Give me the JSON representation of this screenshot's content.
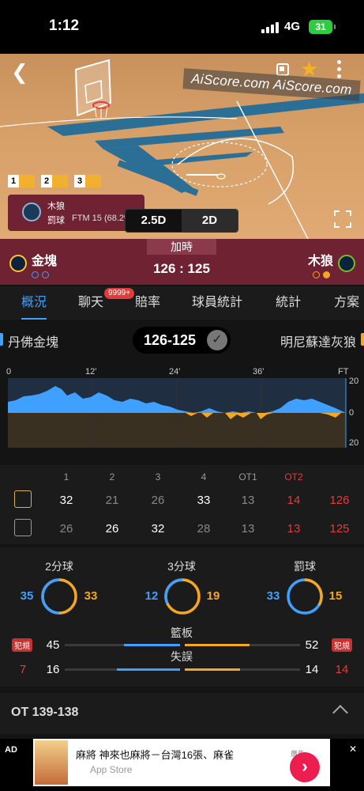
{
  "status": {
    "time": "1:12",
    "network": "4G",
    "battery": "31"
  },
  "court": {
    "watermark": "AiScore.com  AiScore.com",
    "period_markers": [
      "1",
      "2",
      "3"
    ],
    "event": {
      "team": "木狼",
      "type": "罰球",
      "detail": "FTM 15 (68.2%)"
    },
    "view_options": [
      "2.5D",
      "2D"
    ]
  },
  "header": {
    "home_team": "金塊",
    "away_team": "木狼",
    "period": "加時",
    "score": "126  :  125",
    "colors": {
      "home": "#3fa0ff",
      "away": "#f5a623",
      "header_bg": "#6e2232"
    }
  },
  "tabs": [
    "概況",
    "聊天",
    "賠率",
    "球員統計",
    "統計",
    "方案"
  ],
  "chat_badge": "9999+",
  "team_strip": {
    "left": "丹佛金塊",
    "right": "明尼蘇達灰狼",
    "score": "126-125"
  },
  "momentum": {
    "x_ticks": [
      "0",
      "12'",
      "24'",
      "36'",
      "FT"
    ],
    "y_labels": [
      "20",
      "0",
      "20"
    ]
  },
  "quarters": {
    "headers": [
      "1",
      "2",
      "3",
      "4",
      "OT1",
      "OT2"
    ],
    "home": [
      "32",
      "21",
      "26",
      "33",
      "13",
      "14",
      "126"
    ],
    "away": [
      "26",
      "26",
      "32",
      "28",
      "13",
      "13",
      "125"
    ]
  },
  "stats": {
    "rings": [
      {
        "label": "2分球",
        "home": "35",
        "away": "33"
      },
      {
        "label": "3分球",
        "home": "12",
        "away": "19"
      },
      {
        "label": "罰球",
        "home": "33",
        "away": "15"
      }
    ],
    "fouls_badge": "犯規",
    "rebounds": {
      "label": "籃板",
      "home": "45",
      "away": "52"
    },
    "turnovers": {
      "label": "失誤",
      "home": "16",
      "away": "14"
    },
    "fouls": {
      "home": "7",
      "away": "14"
    }
  },
  "ot_row": {
    "label": "OT  139-138"
  },
  "ad": {
    "tag": "AD",
    "title": "麻將 神來也麻將－台灣16張、麻雀",
    "store": "App Store",
    "sponsor": "廣告",
    "cta": "›",
    "close": "✕"
  }
}
